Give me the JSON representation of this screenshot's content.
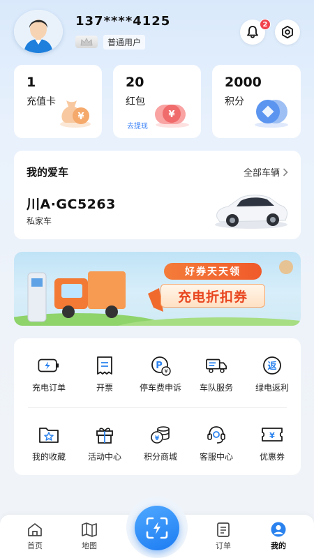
{
  "profile": {
    "phone": "137****4125",
    "level": "普通用户",
    "notifications": "2"
  },
  "stats": [
    {
      "value": "1",
      "label": "充值卡"
    },
    {
      "value": "20",
      "label": "红包",
      "link": "去提现"
    },
    {
      "value": "2000",
      "label": "积分"
    }
  ],
  "car": {
    "title": "我的爱车",
    "all_link": "全部车辆",
    "plate": "川A·GC5263",
    "type": "私家车"
  },
  "banner": {
    "tagline": "好券天天领",
    "headline": "充电折扣券"
  },
  "services": [
    {
      "label": "充电订单",
      "icon": "battery-icon"
    },
    {
      "label": "开票",
      "icon": "receipt-icon"
    },
    {
      "label": "停车费申诉",
      "icon": "parking-fee-icon"
    },
    {
      "label": "车队服务",
      "icon": "truck-icon"
    },
    {
      "label": "绿电返利",
      "icon": "rebate-icon"
    },
    {
      "label": "我的收藏",
      "icon": "star-folder-icon"
    },
    {
      "label": "活动中心",
      "icon": "gift-icon"
    },
    {
      "label": "积分商城",
      "icon": "coins-icon"
    },
    {
      "label": "客服中心",
      "icon": "headset-icon"
    },
    {
      "label": "优惠券",
      "icon": "coupon-icon"
    }
  ],
  "tabs": [
    {
      "label": "首页",
      "icon": "home-icon"
    },
    {
      "label": "地图",
      "icon": "map-icon"
    },
    {
      "label": "订单",
      "icon": "order-icon"
    },
    {
      "label": "我的",
      "icon": "user-icon",
      "active": true
    }
  ],
  "colors": {
    "accent": "#1d7cf2",
    "badge": "#f0424c",
    "banner_orange": "#f0622a"
  }
}
